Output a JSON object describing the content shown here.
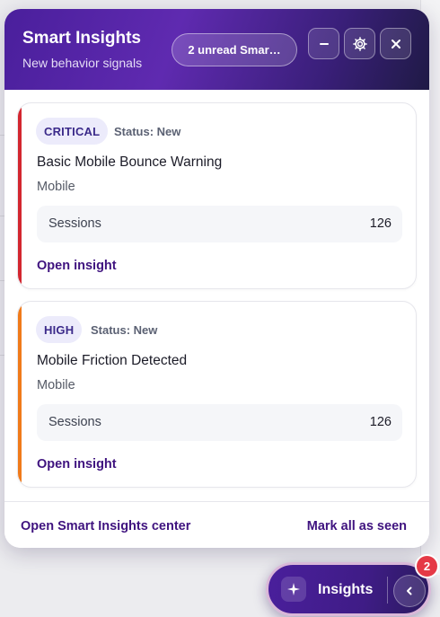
{
  "panel": {
    "title": "Smart Insights",
    "subtitle": "New behavior signals",
    "unread_pill": "2 unread Smar…",
    "buttons": {
      "minimize_icon": "minus-icon",
      "settings_icon": "gear-icon",
      "close_icon": "close-icon"
    },
    "header_gradient": [
      "#4a1f9c",
      "#5f2ab0",
      "#1f1a45"
    ]
  },
  "insights": [
    {
      "severity": "CRITICAL",
      "severity_color": "#d3262f",
      "status": "Status: New",
      "title": "Basic Mobile Bounce Warning",
      "device": "Mobile",
      "metric_label": "Sessions",
      "metric_value": "126",
      "link": "Open insight"
    },
    {
      "severity": "HIGH",
      "severity_color": "#f07a1a",
      "status": "Status: New",
      "title": "Mobile Friction Detected",
      "device": "Mobile",
      "metric_label": "Sessions",
      "metric_value": "126",
      "link": "Open insight"
    }
  ],
  "footer": {
    "open_center": "Open Smart Insights center",
    "mark_all": "Mark all as seen"
  },
  "launcher": {
    "icon": "sparkle-icon",
    "label": "Insights",
    "toggle_icon": "chevron-left-icon",
    "badge_count": "2"
  },
  "colors": {
    "accent": "#3f137f",
    "critical": "#d3262f",
    "high": "#f07a1a",
    "badge_bg": "#ecebfb",
    "notification": "#e53946"
  }
}
